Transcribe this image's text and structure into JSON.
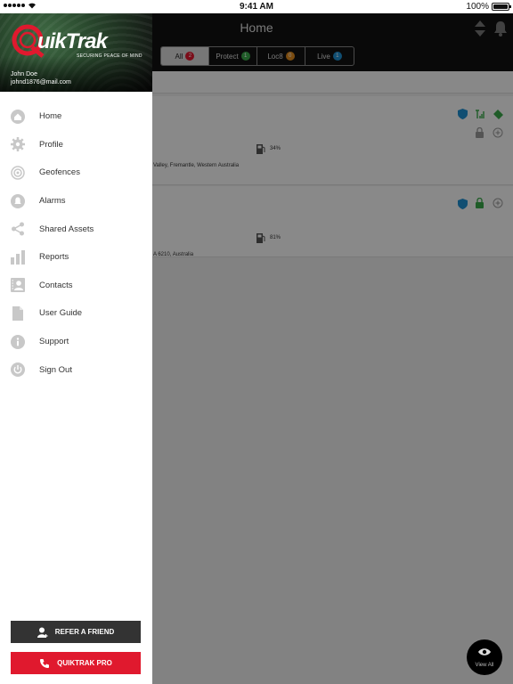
{
  "status_bar": {
    "time": "9:41 AM",
    "battery": "100%",
    "battery_level": 1.0
  },
  "header": {
    "title": "Home",
    "tabs": [
      {
        "label": "All",
        "count": "2",
        "color": "#e0192e",
        "active": true
      },
      {
        "label": "Protect",
        "count": "1",
        "color": "#3aa84a",
        "active": false
      },
      {
        "label": "Loc8",
        "count": "0",
        "color": "#e08a1e",
        "active": false
      },
      {
        "label": "Live",
        "count": "1",
        "color": "#1e8fd0",
        "active": false
      }
    ]
  },
  "assets": [
    {
      "battery_pct": "34%",
      "address_fragment": "Valley, Fremantle, Western Australia"
    },
    {
      "battery_pct": "81%",
      "address_fragment": "A 6210, Australia"
    }
  ],
  "drawer": {
    "logo_text": "uikTrak",
    "tagline": "SECURING PEACE OF MIND",
    "user_name": "John Doe",
    "user_email": "johnd1876@mail.com",
    "menu": [
      {
        "label": "Home",
        "icon": "home-icon"
      },
      {
        "label": "Profile",
        "icon": "gear-icon"
      },
      {
        "label": "Geofences",
        "icon": "geofence-icon"
      },
      {
        "label": "Alarms",
        "icon": "bell-icon"
      },
      {
        "label": "Shared Assets",
        "icon": "share-icon"
      },
      {
        "label": "Reports",
        "icon": "bar-chart-icon"
      },
      {
        "label": "Contacts",
        "icon": "contacts-icon"
      },
      {
        "label": "User Guide",
        "icon": "document-icon"
      },
      {
        "label": "Support",
        "icon": "info-icon"
      },
      {
        "label": "Sign Out",
        "icon": "power-icon"
      }
    ],
    "refer_label": "REFER A FRIEND",
    "pro_label": "QUIKTRAK PRO"
  },
  "view_all_label": "View All",
  "colors": {
    "brand_red": "#e0192e",
    "protect_green": "#3aa84a",
    "shield_blue": "#1e8fd0",
    "menu_icon_gray": "#c8c8c8",
    "dark_button": "#333333"
  }
}
